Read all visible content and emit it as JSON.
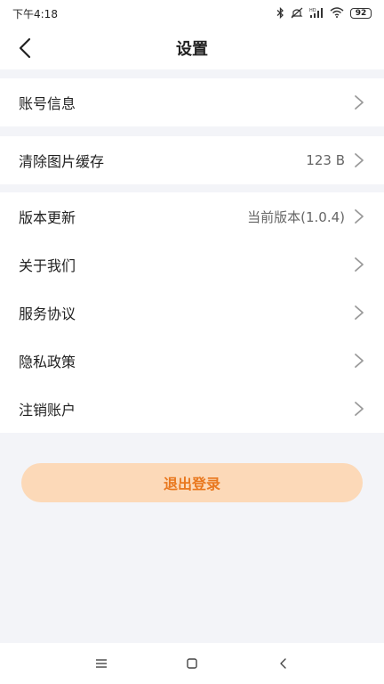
{
  "status_bar": {
    "time": "下午4:18",
    "network_label": "HD",
    "battery": "92"
  },
  "header": {
    "title": "设置"
  },
  "settings": {
    "account": {
      "label": "账号信息"
    },
    "cache": {
      "label": "清除图片缓存",
      "value": "123 B"
    },
    "version": {
      "label": "版本更新",
      "value": "当前版本(1.0.4)"
    },
    "about": {
      "label": "关于我们"
    },
    "service": {
      "label": "服务协议"
    },
    "privacy": {
      "label": "隐私政策"
    },
    "deregister": {
      "label": "注销账户"
    }
  },
  "logout": {
    "label": "退出登录"
  },
  "icons": {
    "back": "chevron-left-icon",
    "row": "chevron-right-icon",
    "menu": "menu-icon",
    "home": "square-icon",
    "system_back": "chevron-left-icon"
  },
  "colors": {
    "accent": "#e9781f",
    "accent_bg": "#fcd9b8",
    "page_bg": "#f3f4f8"
  }
}
